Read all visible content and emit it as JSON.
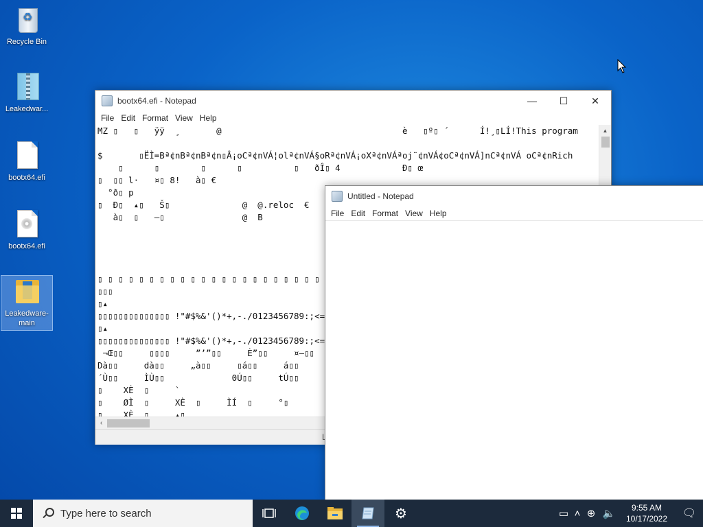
{
  "desktop": {
    "icons": [
      {
        "label": "Recycle Bin"
      },
      {
        "label": "Leakedwar..."
      },
      {
        "label": "bootx64.efi"
      },
      {
        "label": "bootx64.efi"
      },
      {
        "label": "Leakedware-main"
      }
    ]
  },
  "notepad_back": {
    "title": "bootx64.efi - Notepad",
    "menu": [
      "File",
      "Edit",
      "Format",
      "View",
      "Help"
    ],
    "controls": {
      "minimize": "—",
      "maximize": "☐",
      "close": "✕"
    },
    "lines": [
      "MZ ▯   ▯   ÿÿ  ¸       @                                   è   ▯º▯ ´      Í!¸▯LÍ!This program",
      "",
      "$       ▯ËÌ=Bª¢nBª¢nBª¢n▯Â¡oCª¢nVÁ¦olª¢nVÁ§oRª¢nVÁ¡oXª¢nVÁªoj¨¢nVÁ¢oCª¢nVÁ]nCª¢nVÁ oCª¢nRich",
      "    ▯      ▯        ▯      ▯          ▯   ðÎ▯ 4            Ð▯ œ",
      "▯  ▯▯ l·   ¤▯ 8!   à▯ €",
      "  °ð▯ p",
      "▯  Ð▯  ▴▯   Š▯              @  @.reloc  €",
      "   à▯  ▯   –▯               @  B",
      "",
      "",
      "",
      "",
      "▯ ▯ ▯ ▯ ▯ ▯ ▯ ▯ ▯ ▯ ▯ ▯ ▯ ▯ ▯ ▯ ▯ ▯ ▯ ▯ ▯ ▯ , , , , ,",
      "▯▯▯",
      "▯▴",
      "▯▯▯▯▯▯▯▯▯▯▯▯▯▯ !\"#$%&'()*+,-./0123456789:;<=>?@ab",
      "▯▴",
      "▯▯▯▯▯▯▯▯▯▯▯▯▯▯ !\"#$%&'()*+,-./0123456789:;<=>?@AB",
      " ¬Œ▯▯     ▯▯▯▯     ”’”▯▯     È”▯▯     ¤–▯▯     \\˜▯▯",
      "Dà▯▯     dà▯▯     „à▯▯     ▯á▯▯     á▯▯     8á▯▯",
      "´Ù▯▯     ÌÙ▯▯             0Ú▯▯     tÚ▯▯     ´Ú▯▯",
      "▯    XÈ  ▯     `",
      "▯    ØÌ  ▯     XÈ  ▯     ÌÍ  ▯     °▯",
      "▯    XÈ  ▯     ▴▯"
    ],
    "status_fragment": "L"
  },
  "notepad_front": {
    "title": "Untitled - Notepad",
    "menu": [
      "File",
      "Edit",
      "Format",
      "View",
      "Help"
    ],
    "content": ""
  },
  "taskbar": {
    "search_placeholder": "Type here to search",
    "time": "9:55 AM",
    "date": "10/17/2022"
  }
}
